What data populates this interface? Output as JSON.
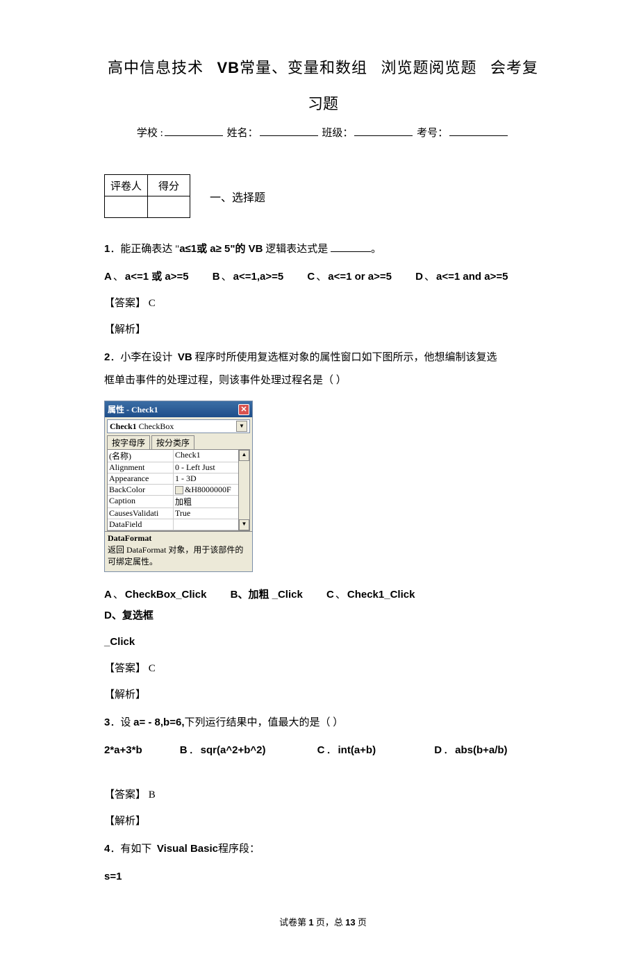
{
  "title": {
    "part1": "高中信息技术",
    "part2": "VB",
    "part3": "常量、变量和数组",
    "part4": "浏览题阅览题",
    "part5": "会考复",
    "line2": "习题"
  },
  "info": {
    "school_label": "学校 :",
    "name_label": "姓名：",
    "class_label": "班级：",
    "examno_label": "考号："
  },
  "score_table": {
    "grader": "评卷人",
    "score": "得分"
  },
  "section1": "一、选择题",
  "q1": {
    "num": "1",
    "text_pre": "．能正确表达   \"",
    "bold1": "a≤1或 a≥ 5\"的 VB",
    "text_post": " 逻辑表达式是",
    "period": "。",
    "optA": "a<=1 或 a>=5",
    "optB": "a<=1,a>=5",
    "optC": "a<=1 or a>=5",
    "optD": "a<=1 and a>=5",
    "answer": "【答案】 C",
    "explain": "【解析】"
  },
  "q2": {
    "num": "2",
    "text1": "．小李在设计",
    "bold1": "VB",
    "text2": " 程序时所使用复选框对象的属性窗口如下图所示，他想编制该复选",
    "text3": "框单击事件的处理过程，则该事件处理过程名是（             ）",
    "optA": "CheckBox_Click",
    "optB_pre": "B、",
    "optB_text": "加粗",
    "optB_suf": "_Click",
    "optC": "Check1_Click",
    "optD_pre": "D、",
    "optD_text": "复选框",
    "optD_suf": "_Click",
    "answer": "【答案】 C",
    "explain": "【解析】"
  },
  "vb": {
    "title": "属性 - Check1",
    "combo_bold": "Check1",
    "combo_rest": " CheckBox",
    "tab1": "按字母序",
    "tab2": "按分类序",
    "rows": [
      {
        "name": "(名称)",
        "val": "Check1"
      },
      {
        "name": "Alignment",
        "val": "0 - Left Just"
      },
      {
        "name": "Appearance",
        "val": "1 - 3D"
      },
      {
        "name": "BackColor",
        "val": "&H8000000F"
      },
      {
        "name": "Caption",
        "val": "加粗"
      },
      {
        "name": "CausesValidati",
        "val": "True"
      },
      {
        "name": "DataField",
        "val": ""
      }
    ],
    "desc_title": "DataFormat",
    "desc_body": "返回 DataFormat 对象，用于该部件的可绑定属性。"
  },
  "q3": {
    "num": "3",
    "text": "．设",
    "bold1": "a= - 8,b=6,",
    "text2": "下列运行结果中，值最大的是（            ）",
    "optA": "2*a+3*b",
    "optB": "sqr(a^2+b^2)",
    "optC": "int(a+b)",
    "optD": "abs(b+a/b)",
    "answer": "【答案】 B",
    "explain": "【解析】"
  },
  "q4": {
    "num": "4",
    "text": "．有如下",
    "bold1": "Visual Basic",
    "text2": "程序段：",
    "code1": "s=1"
  },
  "footer": {
    "pre": "试卷第",
    "page": "1",
    "mid": "页，总",
    "total": "13",
    "suf": "页"
  }
}
